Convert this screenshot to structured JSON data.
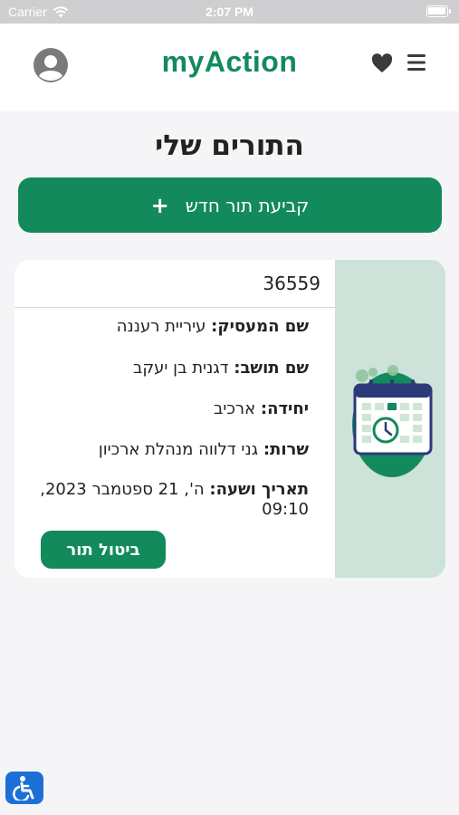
{
  "status_bar": {
    "carrier": "Carrier",
    "time": "2:07 PM"
  },
  "header": {
    "logo": "myAction",
    "icons": {
      "profile": "avatar-icon",
      "favorites": "heart-icon",
      "menu": "hamburger-icon"
    }
  },
  "page": {
    "title": "התורים שלי",
    "new_appointment_button": "קביעת תור חדש",
    "new_appointment_icon": "+"
  },
  "appointment": {
    "id": "36559",
    "employer_label": "שם המעסיק:",
    "employer_value": "עיריית רעננה",
    "resident_label": "שם תושב:",
    "resident_value": "דגנית בן יעקב",
    "unit_label": "יחידה:",
    "unit_value": "ארכיב",
    "service_label": "שרות:",
    "service_value": "גני דלווה מנהלת ארכיון",
    "datetime_label": "תאריך ושעה:",
    "datetime_value": "ה', 21 ספטמבר 2023, 09:10",
    "cancel_button": "ביטול תור",
    "illustration": "calendar-clock-icon"
  },
  "colors": {
    "brand": "#138a5b",
    "card_side": "#cde2d8",
    "accessibility": "#1d6fd6"
  },
  "accessibility_icon": "wheelchair-icon"
}
